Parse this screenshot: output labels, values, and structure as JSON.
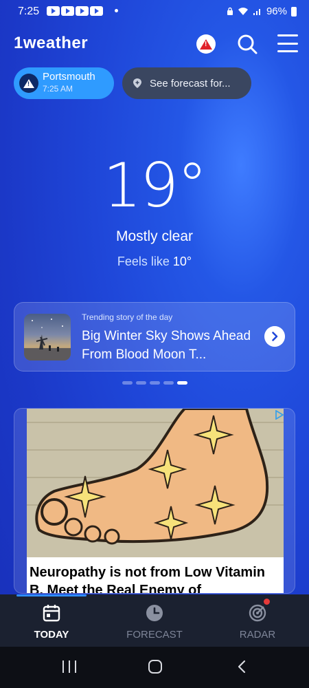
{
  "status_bar": {
    "time": "7:25",
    "battery": "96%"
  },
  "header": {
    "logo": "1weather"
  },
  "location": {
    "name": "Portsmouth",
    "time": "7:25 AM",
    "see_forecast_label": "See forecast for..."
  },
  "current": {
    "temperature": "19°",
    "condition": "Mostly clear",
    "feels_like_prefix": "Feels like",
    "feels_like_value": "10°"
  },
  "trending": {
    "kicker": "Trending story of the day",
    "title": "Big Winter Sky Shows Ahead From Blood Moon T...",
    "pages_total": 5,
    "active_page": 5
  },
  "ad": {
    "caption": "Neuropathy is not from Low Vitamin B. Meet the Real Enemy of"
  },
  "bottom_nav": {
    "today": "TODAY",
    "forecast": "FORECAST",
    "radar": "RADAR"
  },
  "colors": {
    "background": "#1f47d9",
    "location_chip": "#2f9bff",
    "see_forecast_chip": "#3a4660",
    "alert": "#e0202a",
    "nav_bg": "#1b2130",
    "nav_accent": "#2f8cff"
  }
}
